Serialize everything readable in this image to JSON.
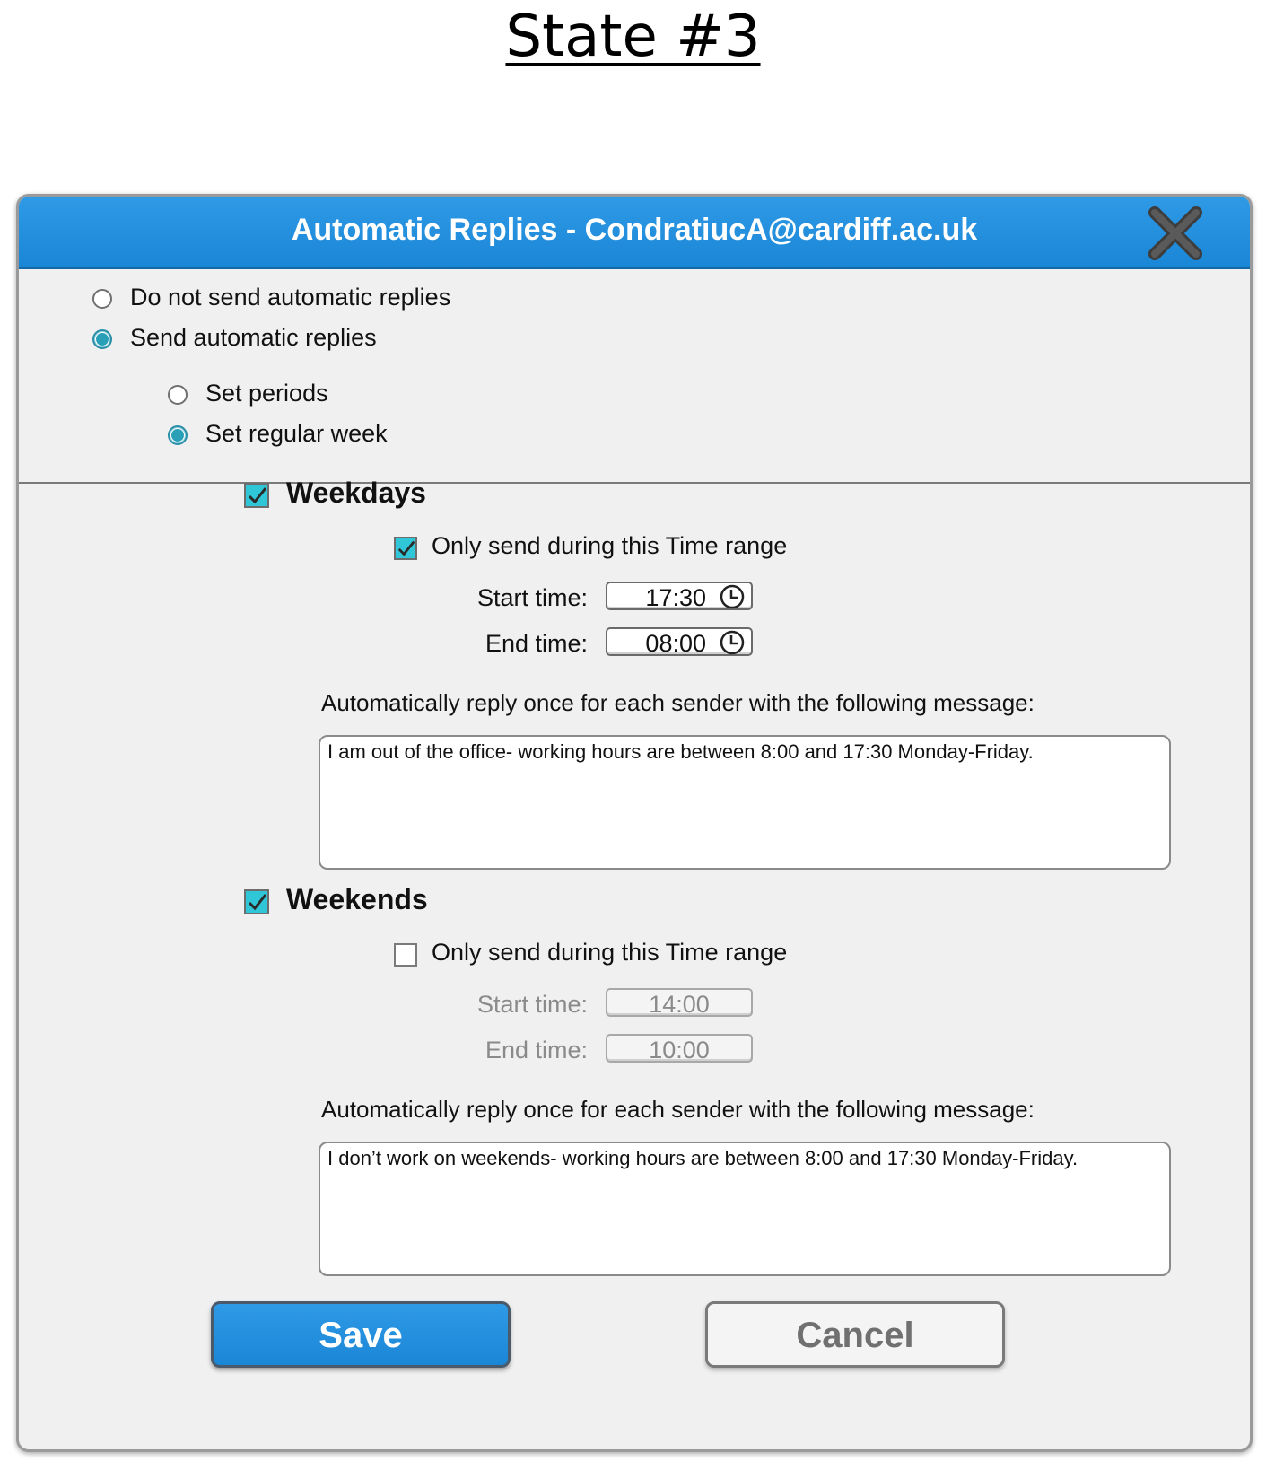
{
  "state_title": "State #3",
  "dialog": {
    "title": "Automatic Replies - CondratiucA@cardiff.ac.uk",
    "close_icon": "close-x-icon"
  },
  "reply_mode": {
    "options": [
      {
        "label": "Do not send automatic replies",
        "checked": false
      },
      {
        "label": "Send automatic replies",
        "checked": true
      }
    ]
  },
  "schedule_mode": {
    "options": [
      {
        "label": "Set periods",
        "checked": false
      },
      {
        "label": "Set regular week",
        "checked": true
      }
    ]
  },
  "weekdays": {
    "label": "Weekdays",
    "checked": true,
    "time_range_label": "Only send during this Time range",
    "time_range_checked": true,
    "start_label": "Start time:",
    "start_value": "17:30",
    "end_label": "End time:",
    "end_value": "08:00",
    "message_label": "Automatically reply once for each sender with the following message:",
    "message": "I am out of the office- working hours are between 8:00 and 17:30 Monday-Friday."
  },
  "weekends": {
    "label": "Weekends",
    "checked": true,
    "time_range_label": "Only send during this Time range",
    "time_range_checked": false,
    "start_label": "Start time:",
    "start_value": "14:00",
    "end_label": "End time:",
    "end_value": "10:00",
    "message_label": "Automatically reply once for each sender with the following message:",
    "message": "I don’t work on weekends- working hours are between 8:00 and 17:30 Monday-Friday."
  },
  "buttons": {
    "save": "Save",
    "cancel": "Cancel"
  },
  "colors": {
    "titlebar": "#1a86d6",
    "checked_accent": "#2fc6d8",
    "radio_accent": "#2aa0b8"
  }
}
